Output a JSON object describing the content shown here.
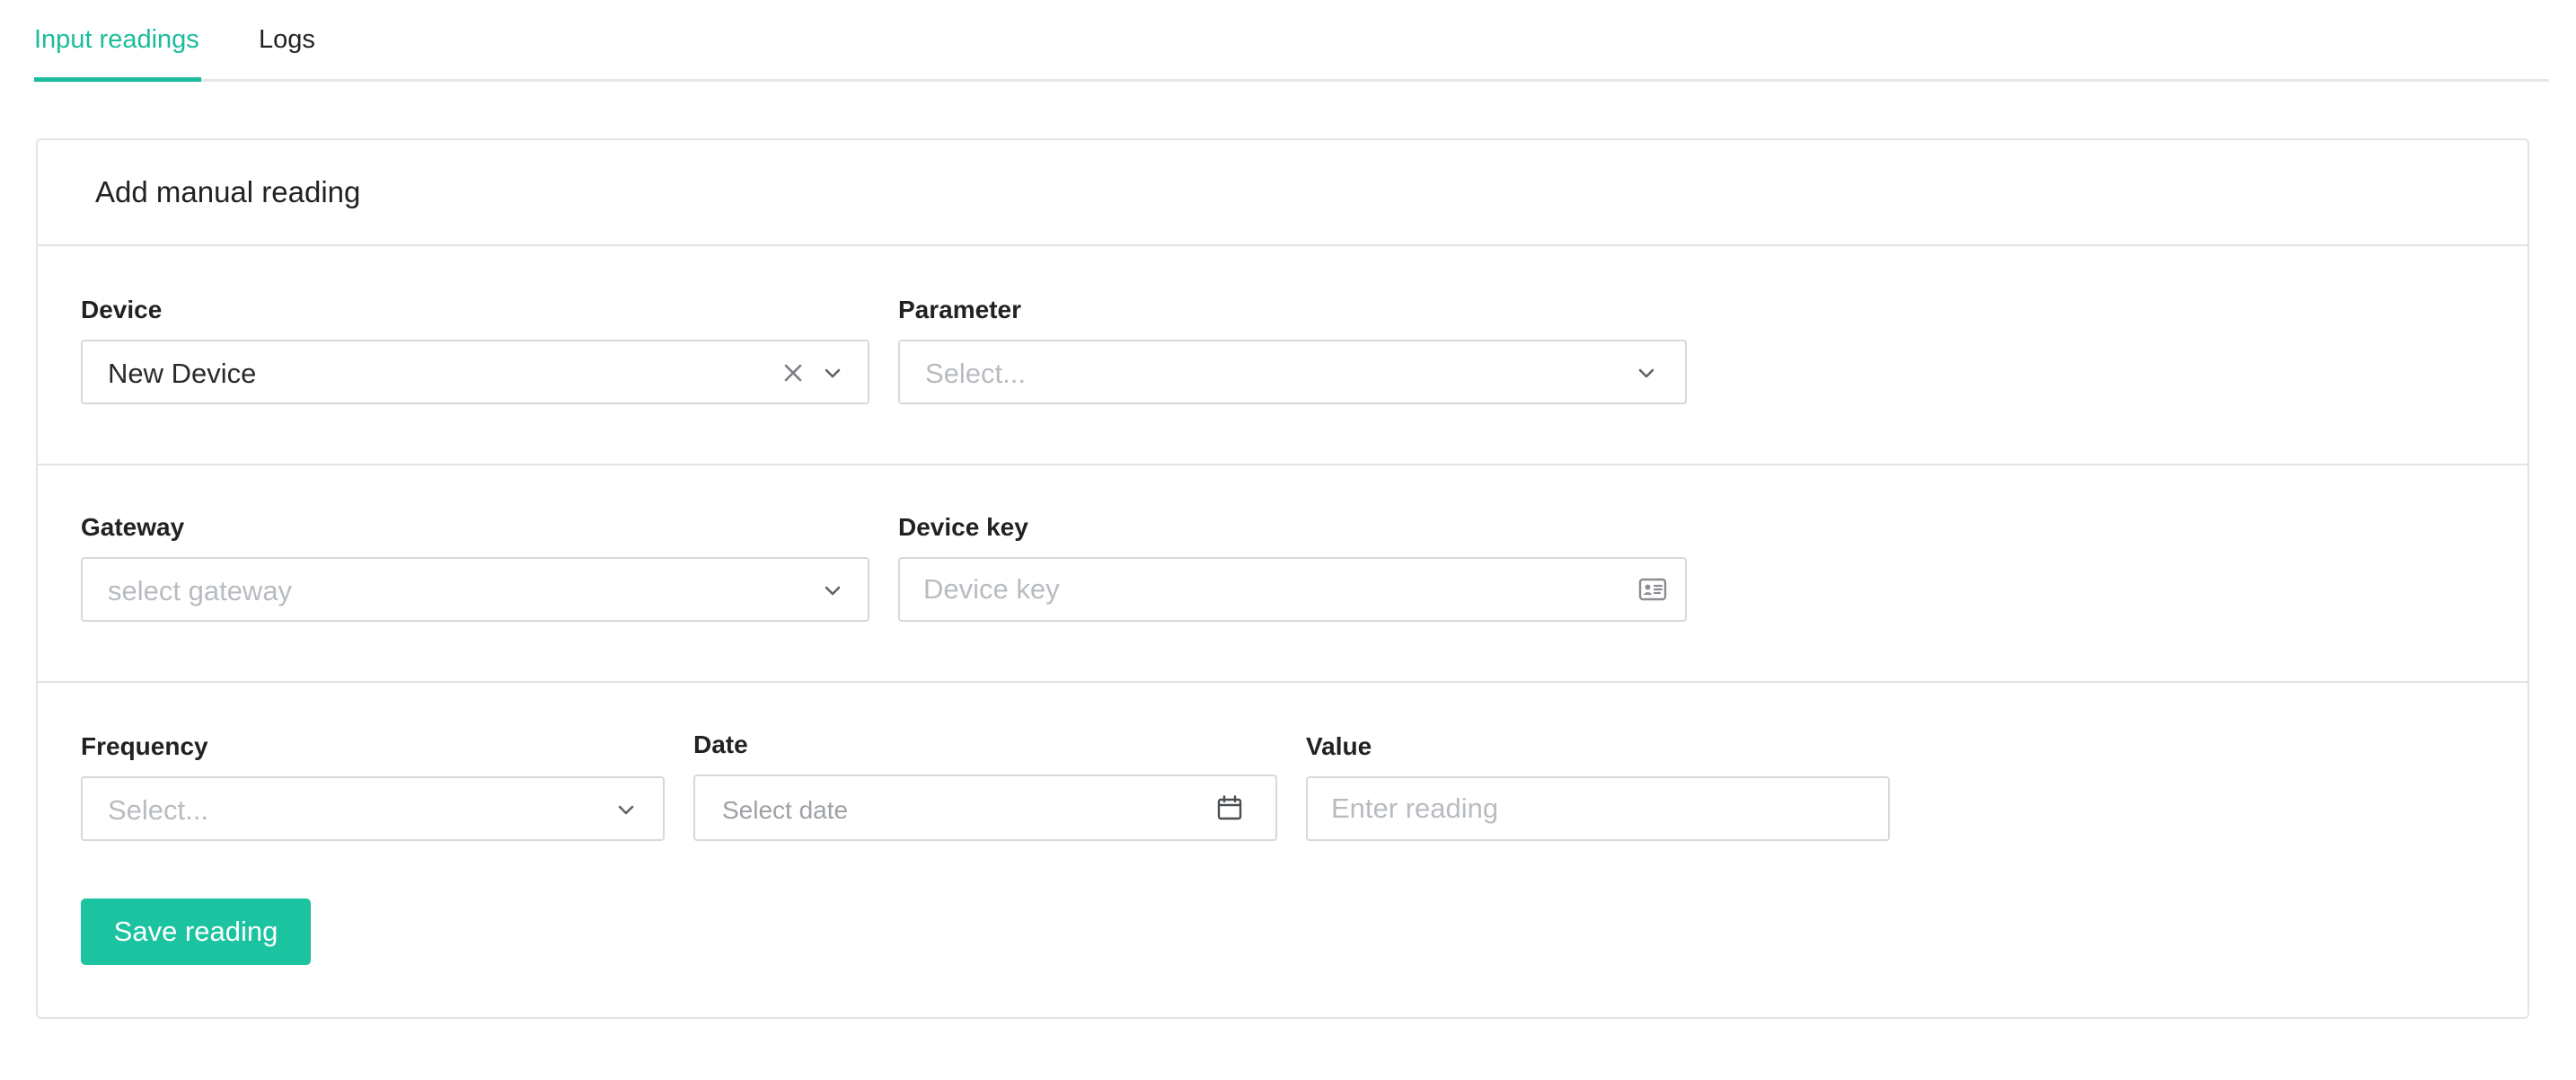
{
  "tabs": [
    {
      "label": "Input readings",
      "active": true
    },
    {
      "label": "Logs",
      "active": false
    }
  ],
  "card": {
    "title": "Add manual reading"
  },
  "form": {
    "device": {
      "label": "Device",
      "value": "New Device"
    },
    "parameter": {
      "label": "Parameter",
      "placeholder": "Select..."
    },
    "gateway": {
      "label": "Gateway",
      "placeholder": "select gateway"
    },
    "device_key": {
      "label": "Device key",
      "placeholder": "Device key"
    },
    "frequency": {
      "label": "Frequency",
      "placeholder": "Select..."
    },
    "date": {
      "label": "Date",
      "placeholder": "Select date"
    },
    "value": {
      "label": "Value",
      "placeholder": "Enter reading"
    }
  },
  "actions": {
    "save_label": "Save reading"
  },
  "colors": {
    "accent": "#1bbc9b",
    "button": "#1bc3a0",
    "border": "#d6d9dc",
    "placeholder": "#b8bcc0"
  },
  "icons": [
    "clear-icon",
    "chevron-down-icon",
    "id-card-icon",
    "calendar-icon"
  ]
}
